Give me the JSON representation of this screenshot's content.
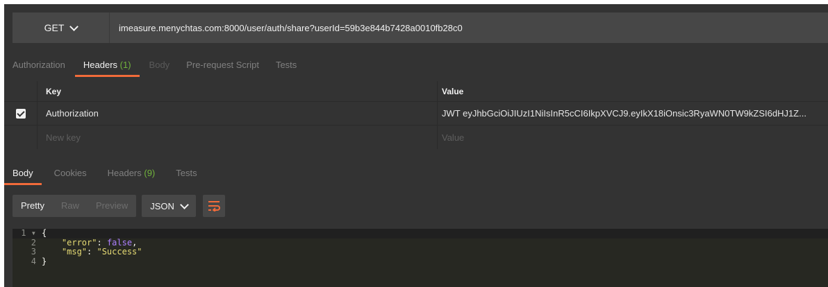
{
  "request": {
    "method": "GET",
    "url": "imeasure.menychtas.com:8000/user/auth/share?userId=59b3e844b7428a0010fb28c0"
  },
  "request_tabs": [
    {
      "label": "Authorization",
      "count": ""
    },
    {
      "label": "Headers",
      "count": "(1)"
    },
    {
      "label": "Body",
      "count": ""
    },
    {
      "label": "Pre-request Script",
      "count": ""
    },
    {
      "label": "Tests",
      "count": ""
    }
  ],
  "headers_table": {
    "columns": [
      "Key",
      "Value"
    ],
    "rows": [
      {
        "checked": true,
        "key": "Authorization",
        "value": "JWT eyJhbGciOiJIUzI1NiIsInR5cCI6IkpXVCJ9.eyIkX18iOnsic3RyaWN0TW9kZSI6dHJ1Z..."
      }
    ],
    "new_key_placeholder": "New key",
    "new_value_placeholder": "Value"
  },
  "response_tabs": [
    {
      "label": "Body",
      "count": ""
    },
    {
      "label": "Cookies",
      "count": ""
    },
    {
      "label": "Headers",
      "count": "(9)"
    },
    {
      "label": "Tests",
      "count": ""
    }
  ],
  "view_modes": [
    "Pretty",
    "Raw",
    "Preview"
  ],
  "format": "JSON",
  "icons": {
    "wrap": "wrap-lines-icon",
    "dropdown": "chevron-down-icon",
    "check": "checkbox-checked-icon"
  },
  "colors": {
    "accent": "#f26b3a",
    "count": "#71b33c",
    "background": "#333333"
  },
  "response_body": {
    "line_numbers": [
      "1",
      "2",
      "3",
      "4"
    ],
    "open_brace": "{",
    "key1": "\"error\"",
    "val1": "false",
    "key2": "\"msg\"",
    "val2": "\"Success\"",
    "close_brace": "}"
  }
}
